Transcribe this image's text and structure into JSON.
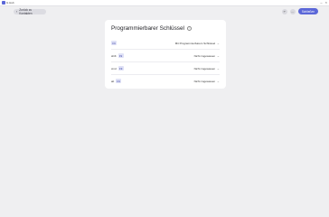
{
  "window": {
    "title": "G Hub"
  },
  "header": {
    "back_label": "Zurück zu Kontakten",
    "save_label": "Schließen"
  },
  "card": {
    "title": "Programmierbarer Schlüssel"
  },
  "rows": [
    {
      "modifier": "",
      "key": "F9",
      "action": "Mit Programmierbarem Schlüssel"
    },
    {
      "modifier": "shift",
      "key": "F9",
      "action": "Nicht zugewiesen"
    },
    {
      "modifier": "cmd",
      "key": "F9",
      "action": "Nicht zugewiesen"
    },
    {
      "modifier": "alt",
      "key": "F9",
      "action": "Nicht zugewiesen"
    }
  ],
  "colors": {
    "accent": "#5b67d8",
    "key_bg": "#dfe1f6",
    "background": "#efeff1"
  }
}
